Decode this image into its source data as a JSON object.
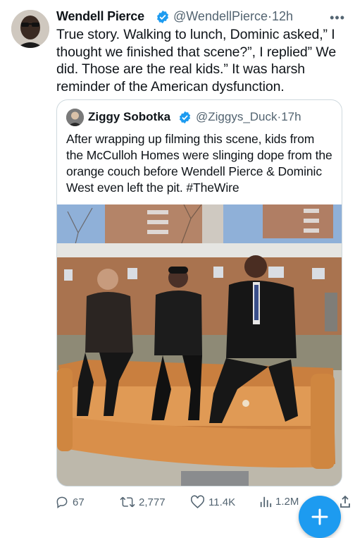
{
  "tweet": {
    "author_name": "Wendell Pierce",
    "handle": "@WendellPierce",
    "time_sep": "·",
    "time": "12h",
    "body": "True story. Walking to lunch, Dominic asked,” I thought we finished that scene?”, I replied” We did. Those are the real kids.” It was harsh reminder of the American dysfunction."
  },
  "quoted_tweet": {
    "author_name": "Ziggy Sobotka",
    "handle": "@Ziggys_Duck",
    "time_sep": "·",
    "time": "17h",
    "body": "After wrapping up filming this scene, kids from the McCulloh Homes were slinging dope from the orange couch before Wendell Pierce & Dominic West even left the pit. #TheWire"
  },
  "actions": {
    "replies": "67",
    "retweets": "2,777",
    "likes": "11.4K",
    "views": "1.2M"
  },
  "icons": [
    "verified-badge-icon",
    "more-icon",
    "reply-icon",
    "retweet-icon",
    "like-icon",
    "views-icon",
    "share-icon",
    "compose-plus-icon"
  ],
  "colors": {
    "accent": "#1d9bf0",
    "secondary_text": "#536471",
    "couch": "#d8924a"
  }
}
